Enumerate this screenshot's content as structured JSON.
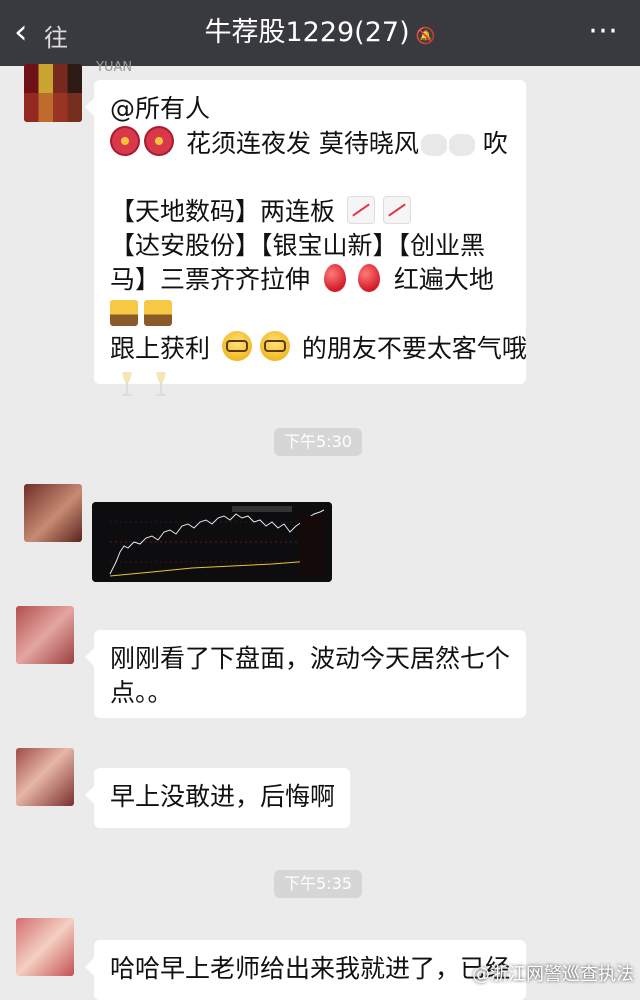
{
  "header": {
    "back_icon": "‹",
    "back_label": "往",
    "title": "牛荐股1229(27)",
    "more_icon": "⋯",
    "mute_icon": "bell-mute-icon"
  },
  "messages": [
    {
      "sender": "YUAN",
      "lines": [
        "@所有人",
        "花须连夜发 莫待晓风",
        "吹",
        "【天地数码】两连板",
        "【达安股份】【银宝山新】【创业黑",
        "马】三票齐齐拉伸",
        "红遍大地",
        "跟上获利",
        "的朋友不要太客气哦"
      ]
    },
    {
      "time": "下午5:30"
    },
    {
      "sender": "",
      "type": "image",
      "caption": "stock-chart-screenshot"
    },
    {
      "sender": "",
      "lines": [
        "刚刚看了下盘面，波动今天居然七个",
        "点。。"
      ]
    },
    {
      "sender": "",
      "lines": [
        "早上没敢进，后悔啊"
      ]
    },
    {
      "time": "下午5:35"
    },
    {
      "sender": "",
      "lines": [
        "哈哈早上老师给出来我就进了，已经"
      ]
    }
  ],
  "watermark": "@浙江网警巡查执法",
  "colors": {
    "topbar": "#393a3f",
    "background": "#ebebeb",
    "bubble": "#ffffff",
    "time_chip": "#d6d6d6"
  }
}
